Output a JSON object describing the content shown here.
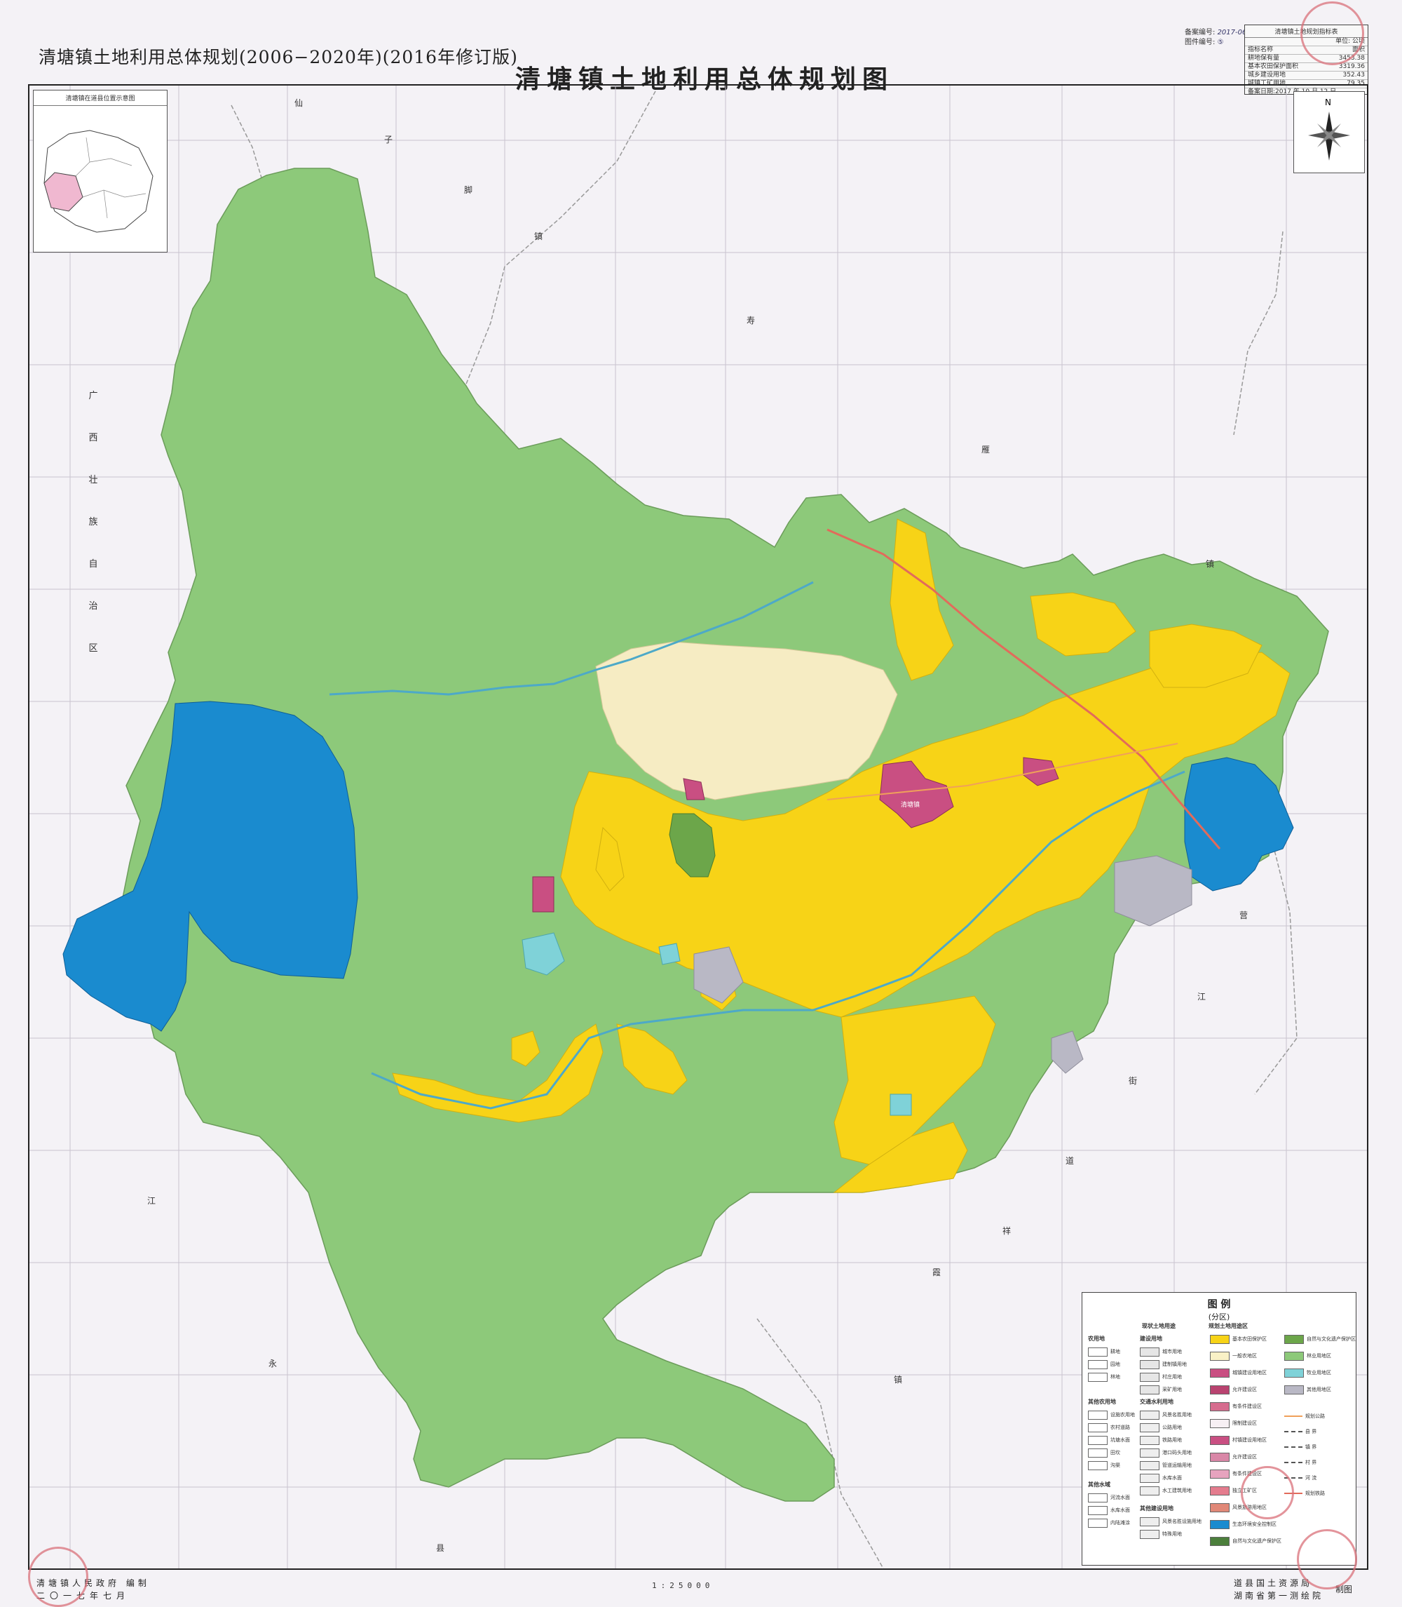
{
  "header": {
    "subtitle": "清塘镇土地利用总体规划(2006−2020年)(2016年修订版)",
    "title": "清塘镇土地利用总体规划图"
  },
  "record": {
    "labels": [
      "备案编号:",
      "图件编号:"
    ],
    "values": [
      "2017-06",
      "⑤"
    ],
    "table_title": "清塘镇土地规划指标表",
    "rows": [
      {
        "name": "指标名称",
        "value": "面积"
      },
      {
        "name": "耕地保有量",
        "value": "3453.38"
      },
      {
        "name": "基本农田保护面积",
        "value": "3319.36"
      },
      {
        "name": "城乡建设用地",
        "value": "352.43"
      },
      {
        "name": "城镇工矿用地",
        "value": "79.35"
      }
    ],
    "unit": "单位: 公顷",
    "date": "备案日期:2017 年 10 月 12 日"
  },
  "inset": {
    "title": "清塘镇在道县位置示意图"
  },
  "compass": {
    "north": "N"
  },
  "place_labels": {
    "left_region": [
      "广",
      "西",
      "壮",
      "族",
      "自",
      "治",
      "区"
    ],
    "top": [
      "仙",
      "子",
      "脚",
      "镇",
      "寿",
      "雁"
    ],
    "right": [
      "镇",
      "营",
      "江",
      "街",
      "道",
      "祥",
      "霞"
    ],
    "bottom": [
      "江",
      "永",
      "县",
      "镇"
    ]
  },
  "map_labels": {
    "town": "清塘镇"
  },
  "legend": {
    "title": "图  例",
    "subtitle": "(分区)",
    "col1_heading": "现状土地用途",
    "col3_heading": "规划土地用途区",
    "groups": {
      "agri": "农用地",
      "construct": "建设用地",
      "other_agri": "其他农用地",
      "traffic": "交通水利用地",
      "water": "其他水域",
      "other_construct": "其他建设用地"
    },
    "left_items": [
      "耕地",
      "园地",
      "林地",
      "设施农用地",
      "农村道路",
      "坑塘水面",
      "田坎",
      "沟渠",
      "河流水面",
      "水库水面",
      "内陆滩涂"
    ],
    "mid_items": [
      "城市用地",
      "建制镇用地",
      "村庄用地",
      "采矿用地",
      "风景名胜用地",
      "公路用地",
      "铁路用地",
      "港口码头用地",
      "管道运输用地",
      "水库水面",
      "水工建筑用地",
      "风景名胜设施用地",
      "特殊用地"
    ],
    "right_items": [
      {
        "label": "基本农田保护区",
        "color": "#f7d317"
      },
      {
        "label": "一般农地区",
        "color": "#f9f1c6"
      },
      {
        "label": "城镇建设用地区",
        "color": "#c94f82"
      },
      {
        "label": "允许建设区",
        "color": "#b94370"
      },
      {
        "label": "有条件建设区",
        "color": "#d66c8e"
      },
      {
        "label": "限制建设区",
        "color": "#f7f0f4"
      },
      {
        "label": "村镇建设用地区",
        "color": "#c94f82"
      },
      {
        "label": "允许建设区",
        "color": "#d987a7"
      },
      {
        "label": "有条件建设区",
        "color": "#e6a3be"
      },
      {
        "label": "独立工矿区",
        "color": "#e47c8e"
      },
      {
        "label": "风景旅游用地区",
        "color": "#e18878"
      },
      {
        "label": "生态环境安全控制区",
        "color": "#1a8bcf"
      },
      {
        "label": "自然与文化遗产保护区",
        "color": "#4c7f3c"
      }
    ],
    "far_items": [
      {
        "label": "自然与文化遗产保护区",
        "color": "#6ca64a"
      },
      {
        "label": "林业用地区",
        "color": "#8dc97a"
      },
      {
        "label": "牧业用地区",
        "color": "#7fd2d8"
      },
      {
        "label": "其他用地区",
        "color": "#b9b8c5"
      }
    ],
    "line_items": [
      "规划公路",
      "县  界",
      "镇  界",
      "村  界",
      "河  流",
      "规划铁路"
    ]
  },
  "footer": {
    "left1": "清塘镇人民政府 编制",
    "left2": "二〇一七年七月",
    "scale": "1:25000",
    "right1": "道县国土资源局",
    "right2": "湖南省第一测绘院",
    "right3": "制图"
  },
  "colors": {
    "forest": "#8dc97a",
    "basic_farmland": "#f7d317",
    "general_farmland": "#f9f1c6",
    "town": "#c94f82",
    "eco_control": "#1a8bcf",
    "other": "#b9b8c5",
    "water": "#7fd2d8",
    "heritage": "#6ca64a"
  }
}
